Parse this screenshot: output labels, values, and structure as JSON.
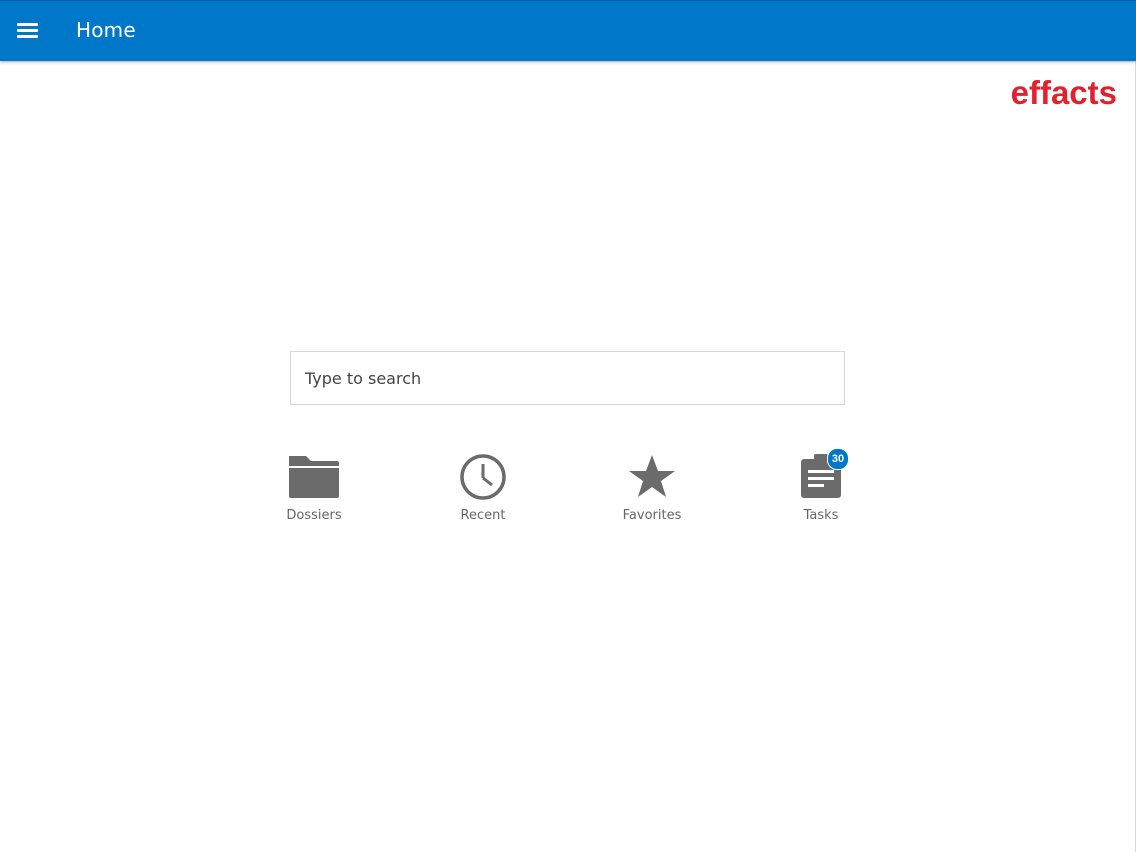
{
  "appbar": {
    "title": "Home",
    "color": "#0077c8",
    "menu_icon": "menu-icon"
  },
  "brand": {
    "logo_text": "effacts",
    "color": "#e0222f"
  },
  "search": {
    "placeholder": "Type to search",
    "value": ""
  },
  "shortcuts": [
    {
      "label": "Dossiers",
      "icon": "folder-icon"
    },
    {
      "label": "Recent",
      "icon": "clock-icon"
    },
    {
      "label": "Favorites",
      "icon": "star-icon"
    },
    {
      "label": "Tasks",
      "icon": "clipboard-icon",
      "badge": "30"
    }
  ],
  "colors": {
    "icon": "#6b6b6b",
    "label": "#666666",
    "badge": "#0077c8"
  }
}
